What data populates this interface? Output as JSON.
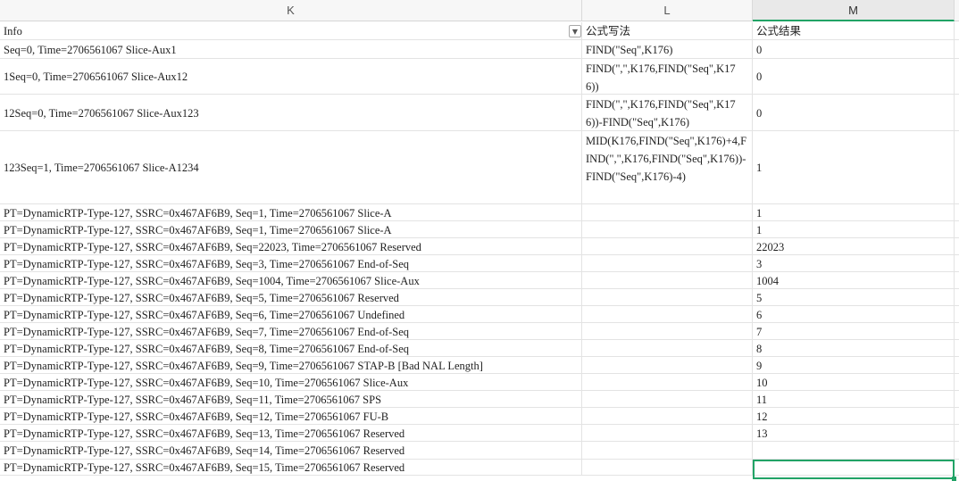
{
  "columns": {
    "k": "K",
    "l": "L",
    "m": "M"
  },
  "header_row": {
    "info": "Info",
    "formula": "公式写法",
    "result": "公式结果",
    "filter_icon": "chevron-down-icon"
  },
  "rows": [
    {
      "info": "Seq=0, Time=2706561067 Slice-Aux1",
      "formula": "FIND(\"Seq\",K176)",
      "result": "0"
    },
    {
      "info": "1Seq=0, Time=2706561067 Slice-Aux12",
      "formula": "FIND(\",\",K176,FIND(\"Seq\",K176))",
      "result": "0"
    },
    {
      "info": "12Seq=0, Time=2706561067 Slice-Aux123",
      "formula": "FIND(\",\",K176,FIND(\"Seq\",K176))-FIND(\"Seq\",K176)",
      "result": "0"
    },
    {
      "info": "123Seq=1, Time=2706561067 Slice-A1234",
      "formula": "MID(K176,FIND(\"Seq\",K176)+4,FIND(\",\",K176,FIND(\"Seq\",K176))-FIND(\"Seq\",K176)-4)",
      "result": "1"
    },
    {
      "info": "PT=DynamicRTP-Type-127, SSRC=0x467AF6B9, Seq=1, Time=2706561067 Slice-A",
      "formula": "",
      "result": "1"
    },
    {
      "info": "PT=DynamicRTP-Type-127, SSRC=0x467AF6B9, Seq=1, Time=2706561067 Slice-A",
      "formula": "",
      "result": "1"
    },
    {
      "info": "PT=DynamicRTP-Type-127, SSRC=0x467AF6B9, Seq=22023, Time=2706561067 Reserved",
      "formula": "",
      "result": "22023"
    },
    {
      "info": "PT=DynamicRTP-Type-127, SSRC=0x467AF6B9, Seq=3, Time=2706561067 End-of-Seq",
      "formula": "",
      "result": "3"
    },
    {
      "info": "PT=DynamicRTP-Type-127, SSRC=0x467AF6B9, Seq=1004, Time=2706561067 Slice-Aux",
      "formula": "",
      "result": "1004"
    },
    {
      "info": "PT=DynamicRTP-Type-127, SSRC=0x467AF6B9, Seq=5, Time=2706561067 Reserved",
      "formula": "",
      "result": "5"
    },
    {
      "info": "PT=DynamicRTP-Type-127, SSRC=0x467AF6B9, Seq=6, Time=2706561067 Undefined",
      "formula": "",
      "result": "6"
    },
    {
      "info": "PT=DynamicRTP-Type-127, SSRC=0x467AF6B9, Seq=7, Time=2706561067 End-of-Seq",
      "formula": "",
      "result": "7"
    },
    {
      "info": "PT=DynamicRTP-Type-127, SSRC=0x467AF6B9, Seq=8, Time=2706561067 End-of-Seq",
      "formula": "",
      "result": "8"
    },
    {
      "info": "PT=DynamicRTP-Type-127, SSRC=0x467AF6B9, Seq=9, Time=2706561067 STAP-B  [Bad NAL Length]",
      "formula": "",
      "result": "9"
    },
    {
      "info": "PT=DynamicRTP-Type-127, SSRC=0x467AF6B9, Seq=10, Time=2706561067 Slice-Aux",
      "formula": "",
      "result": "10"
    },
    {
      "info": "PT=DynamicRTP-Type-127, SSRC=0x467AF6B9, Seq=11, Time=2706561067 SPS",
      "formula": "",
      "result": "11"
    },
    {
      "info": "PT=DynamicRTP-Type-127, SSRC=0x467AF6B9, Seq=12, Time=2706561067 FU-B",
      "formula": "",
      "result": "12"
    },
    {
      "info": "PT=DynamicRTP-Type-127, SSRC=0x467AF6B9, Seq=13, Time=2706561067 Reserved",
      "formula": "",
      "result": "13"
    },
    {
      "info": "PT=DynamicRTP-Type-127, SSRC=0x467AF6B9, Seq=14, Time=2706561067 Reserved",
      "formula": "",
      "result": ""
    },
    {
      "info": "PT=DynamicRTP-Type-127, SSRC=0x467AF6B9, Seq=15, Time=2706561067 Reserved",
      "formula": "",
      "result": ""
    }
  ],
  "colors": {
    "accent": "#21a366",
    "gridline": "#e3e3e3",
    "header_bg": "#f7f7f7"
  }
}
